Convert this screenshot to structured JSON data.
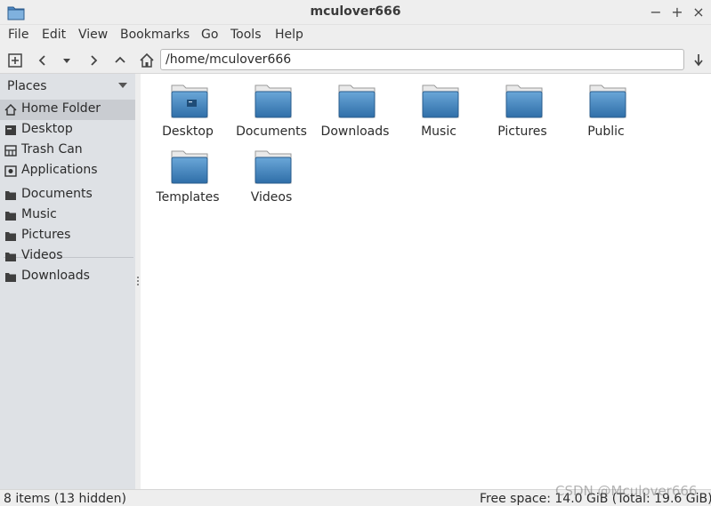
{
  "window": {
    "title": "mculover666",
    "controls": {
      "minimize": "−",
      "maximize": "+",
      "close": "×"
    }
  },
  "menu": [
    "File",
    "Edit",
    "View",
    "Bookmarks",
    "Go",
    "Tools",
    "Help"
  ],
  "toolbar": {
    "icons": [
      "new-tab-icon",
      "back-icon",
      "history-dropdown-icon",
      "forward-icon",
      "up-icon",
      "home-icon",
      "go-icon"
    ],
    "path": "/home/mculover666"
  },
  "sidebar": {
    "header": "Places",
    "places": [
      {
        "label": "Home Folder",
        "icon": "home-icon",
        "active": true
      },
      {
        "label": "Desktop",
        "icon": "desktop-icon"
      },
      {
        "label": "Trash Can",
        "icon": "trash-icon"
      },
      {
        "label": "Applications",
        "icon": "applications-icon"
      }
    ],
    "bookmarks": [
      {
        "label": "Documents",
        "icon": "folder-icon"
      },
      {
        "label": "Music",
        "icon": "folder-icon"
      },
      {
        "label": "Pictures",
        "icon": "folder-icon"
      },
      {
        "label": "Videos",
        "icon": "folder-icon"
      },
      {
        "label": "Downloads",
        "icon": "folder-icon"
      }
    ]
  },
  "files": [
    {
      "name": "Desktop",
      "icon": "desktop-folder-icon"
    },
    {
      "name": "Documents",
      "icon": "folder-icon"
    },
    {
      "name": "Downloads",
      "icon": "folder-icon"
    },
    {
      "name": "Music",
      "icon": "folder-icon"
    },
    {
      "name": "Pictures",
      "icon": "folder-icon"
    },
    {
      "name": "Public",
      "icon": "folder-icon"
    },
    {
      "name": "Templates",
      "icon": "folder-icon"
    },
    {
      "name": "Videos",
      "icon": "folder-icon"
    }
  ],
  "status": {
    "items": "8 items (13 hidden)",
    "free_space": "Free space: 14.0 GiB (Total: 19.6 GiB)"
  },
  "watermark": "CSDN @Mculover666",
  "colors": {
    "folder_top": "#6aa7d8",
    "folder_bottom": "#2f6ea8",
    "sidebar_bg": "#dee1e5",
    "active_item": "#c9ccd1"
  }
}
